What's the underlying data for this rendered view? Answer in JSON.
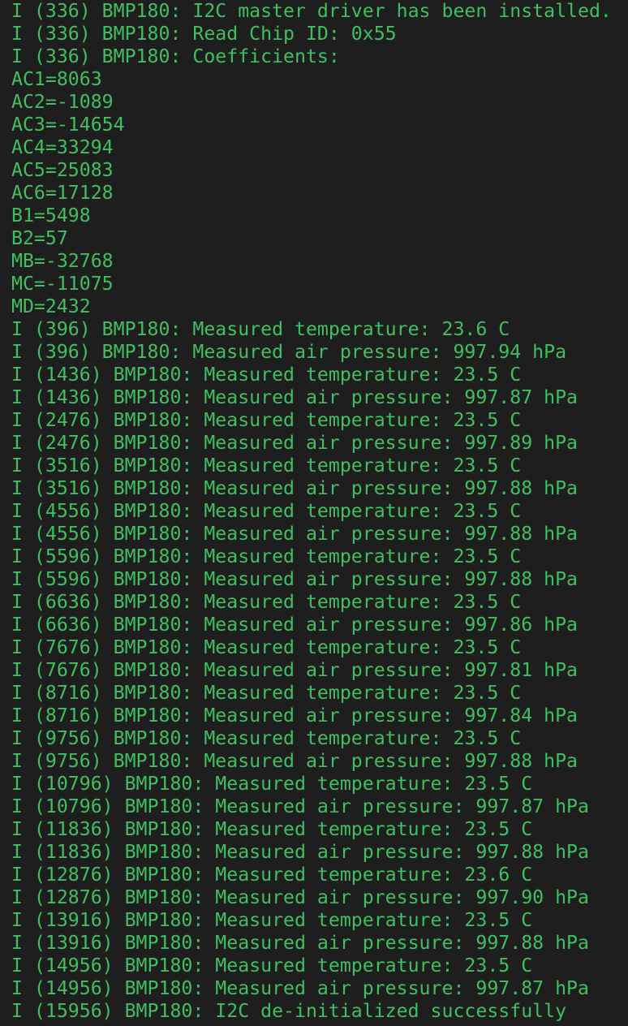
{
  "terminal": {
    "text_color": "#3fbf5f",
    "background_color": "#1e1e1e",
    "lines": [
      "I (336) BMP180: I2C master driver has been installed.",
      "I (336) BMP180: Read Chip ID: 0x55",
      "I (336) BMP180: Coefficients:",
      "AC1=8063",
      "AC2=-1089",
      "AC3=-14654",
      "AC4=33294",
      "AC5=25083",
      "AC6=17128",
      "B1=5498",
      "B2=57",
      "MB=-32768",
      "MC=-11075",
      "MD=2432",
      "I (396) BMP180: Measured temperature: 23.6 C",
      "I (396) BMP180: Measured air pressure: 997.94 hPa",
      "I (1436) BMP180: Measured temperature: 23.5 C",
      "I (1436) BMP180: Measured air pressure: 997.87 hPa",
      "I (2476) BMP180: Measured temperature: 23.5 C",
      "I (2476) BMP180: Measured air pressure: 997.89 hPa",
      "I (3516) BMP180: Measured temperature: 23.5 C",
      "I (3516) BMP180: Measured air pressure: 997.88 hPa",
      "I (4556) BMP180: Measured temperature: 23.5 C",
      "I (4556) BMP180: Measured air pressure: 997.88 hPa",
      "I (5596) BMP180: Measured temperature: 23.5 C",
      "I (5596) BMP180: Measured air pressure: 997.88 hPa",
      "I (6636) BMP180: Measured temperature: 23.5 C",
      "I (6636) BMP180: Measured air pressure: 997.86 hPa",
      "I (7676) BMP180: Measured temperature: 23.5 C",
      "I (7676) BMP180: Measured air pressure: 997.81 hPa",
      "I (8716) BMP180: Measured temperature: 23.5 C",
      "I (8716) BMP180: Measured air pressure: 997.84 hPa",
      "I (9756) BMP180: Measured temperature: 23.5 C",
      "I (9756) BMP180: Measured air pressure: 997.88 hPa",
      "I (10796) BMP180: Measured temperature: 23.5 C",
      "I (10796) BMP180: Measured air pressure: 997.87 hPa",
      "I (11836) BMP180: Measured temperature: 23.5 C",
      "I (11836) BMP180: Measured air pressure: 997.88 hPa",
      "I (12876) BMP180: Measured temperature: 23.6 C",
      "I (12876) BMP180: Measured air pressure: 997.90 hPa",
      "I (13916) BMP180: Measured temperature: 23.5 C",
      "I (13916) BMP180: Measured air pressure: 997.88 hPa",
      "I (14956) BMP180: Measured temperature: 23.5 C",
      "I (14956) BMP180: Measured air pressure: 997.87 hPa",
      "I (15956) BMP180: I2C de-initialized successfully"
    ]
  }
}
